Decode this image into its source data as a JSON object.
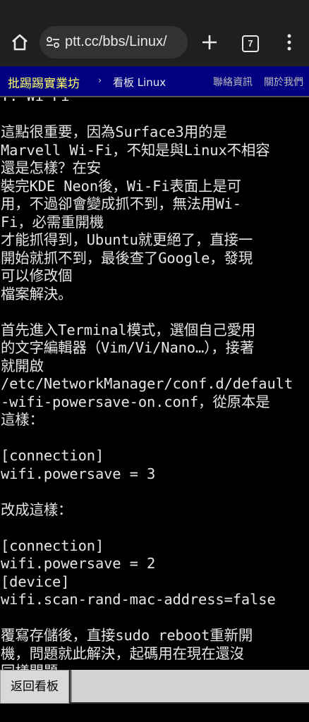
{
  "browser": {
    "url": "ptt.cc/bbs/Linux/",
    "tab_count": "7"
  },
  "nav": {
    "logo": "批踢踢實業坊",
    "separator": "›",
    "board": "看板 Linux",
    "contact": "聯絡資訊",
    "about": "關於我們"
  },
  "article": {
    "lines": [
      "T: Wi-Fi",
      "",
      "這點很重要，因為Surface3用的是",
      "Marvell Wi-Fi，不知是與Linux不相容",
      "還是怎樣？在安",
      "裝完KDE Neon後，Wi-Fi表面上是可",
      "用，不過卻會變成抓不到，無法用Wi-",
      "Fi，必需重開機",
      "才能抓得到，Ubuntu就更絕了，直接一",
      "開始就抓不到，最後查了Google，發現",
      "可以修改個",
      "檔案解決。",
      "",
      "首先進入Terminal模式，選個自己愛用",
      "的文字編輯器（Vim/Vi/Nano…），接著",
      "就開啟",
      "/etc/NetworkManager/conf.d/default",
      "-wifi-powersave-on.conf，從原本是",
      "這樣：",
      "",
      "[connection]",
      "wifi.powersave = 3",
      "",
      "改成這樣：",
      "",
      "[connection]",
      "wifi.powersave = 2",
      "[device]",
      "wifi.scan-rand-mac-address=false",
      "",
      "覆寫存儲後，直接sudo reboot重新開",
      "機，問題就此解決，起碼用在現在還沒",
      "同樣問題。"
    ]
  },
  "bottom": {
    "back_label": "返回看板"
  }
}
